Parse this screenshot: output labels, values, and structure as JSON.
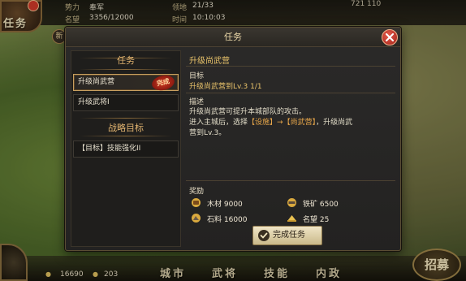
{
  "top": {
    "force_label": "势力",
    "force_value": "奉军",
    "fame_label": "名望",
    "fame_value": "3356/12000",
    "territory_label": "领地",
    "territory_value": "21/33",
    "time_label": "时间",
    "time_value": "10:10:03",
    "coords": "721 110",
    "task_nav": "任务",
    "new_badge": "新"
  },
  "bottom": {
    "coin_value": "16690",
    "gold_value": "203",
    "tabs": [
      "城市",
      "武将",
      "技能",
      "内政"
    ],
    "recruit": "招募"
  },
  "modal": {
    "title": "任务",
    "left": {
      "tasks_header": "任务",
      "tasks": [
        {
          "label": "升级尚武营",
          "completed": true,
          "stamp": "完成"
        },
        {
          "label": "升级武将I",
          "completed": false
        }
      ],
      "strategy_header": "战略目标",
      "strategy_items": [
        {
          "label": "【目标】技能强化II"
        }
      ]
    },
    "detail": {
      "title": "升级尚武营",
      "target_label": "目标",
      "target_text": "升级尚武营到Lv.3 1/1",
      "desc_label": "描述",
      "desc_line1": "升级尚武营可提升本城部队的攻击。",
      "desc_line2_pre": "进入主城后，选择",
      "desc_hl1": "【设施】",
      "desc_arrow": "→",
      "desc_hl2": "【尚武营】",
      "desc_line2_post": "，升级尚武",
      "desc_line3": "营到Lv.3。",
      "reward_label": "奖励",
      "rewards": [
        {
          "icon": "wood-icon",
          "text": "木材 9000"
        },
        {
          "icon": "iron-icon",
          "text": "铁矿 6500"
        },
        {
          "icon": "stone-icon",
          "text": "石料 16000"
        },
        {
          "icon": "fame-icon",
          "text": "名望 25"
        }
      ],
      "complete_button": "完成任务"
    }
  }
}
